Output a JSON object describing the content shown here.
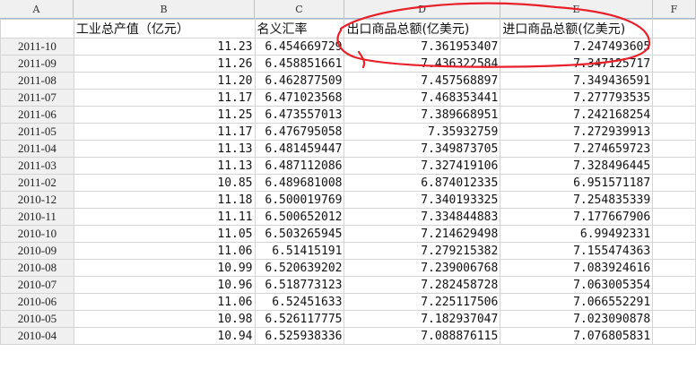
{
  "columns": [
    "A",
    "B",
    "C",
    "D",
    "E",
    "F"
  ],
  "header_row": [
    "",
    "工业总产值（亿元）",
    "名义汇率",
    "出口商品总额(亿美元)",
    "进口商品总额(亿美元)",
    ""
  ],
  "rows": [
    [
      "2011-10",
      "11.23",
      "6.454669729",
      "7.361953407",
      "7.247493605"
    ],
    [
      "2011-09",
      "11.26",
      "6.458851661",
      "7.436322584",
      "7.347125717"
    ],
    [
      "2011-08",
      "11.20",
      "6.462877509",
      "7.457568897",
      "7.349436591"
    ],
    [
      "2011-07",
      "11.17",
      "6.471023568",
      "7.468353441",
      "7.277793535"
    ],
    [
      "2011-06",
      "11.25",
      "6.473557013",
      "7.389668951",
      "7.242168254"
    ],
    [
      "2011-05",
      "11.17",
      "6.476795058",
      "7.35932759",
      "7.272939913"
    ],
    [
      "2011-04",
      "11.13",
      "6.481459447",
      "7.349873705",
      "7.274659723"
    ],
    [
      "2011-03",
      "11.13",
      "6.487112086",
      "7.327419106",
      "7.328496445"
    ],
    [
      "2011-02",
      "10.85",
      "6.489681008",
      "6.874012335",
      "6.951571187"
    ],
    [
      "2010-12",
      "11.18",
      "6.500019769",
      "7.340193325",
      "7.254835339"
    ],
    [
      "2010-11",
      "11.11",
      "6.500652012",
      "7.334844883",
      "7.177667906"
    ],
    [
      "2010-10",
      "11.05",
      "6.503265945",
      "7.214629498",
      "6.99492331"
    ],
    [
      "2010-09",
      "11.06",
      "6.51415191",
      "7.279215382",
      "7.155474363"
    ],
    [
      "2010-08",
      "10.99",
      "6.520639202",
      "7.239006768",
      "7.083924616"
    ],
    [
      "2010-07",
      "10.96",
      "6.518773123",
      "7.282458728",
      "7.063005354"
    ],
    [
      "2010-06",
      "11.06",
      "6.52451633",
      "7.225117506",
      "7.066552291"
    ],
    [
      "2010-05",
      "10.98",
      "6.526117775",
      "7.182937047",
      "7.023090878"
    ],
    [
      "2010-04",
      "10.94",
      "6.525938336",
      "7.088876115",
      "7.076805831"
    ]
  ],
  "annotation_color": "#e8202a",
  "grid_line_color": "#d4d4d4",
  "header_bg": "#f0f0f0"
}
